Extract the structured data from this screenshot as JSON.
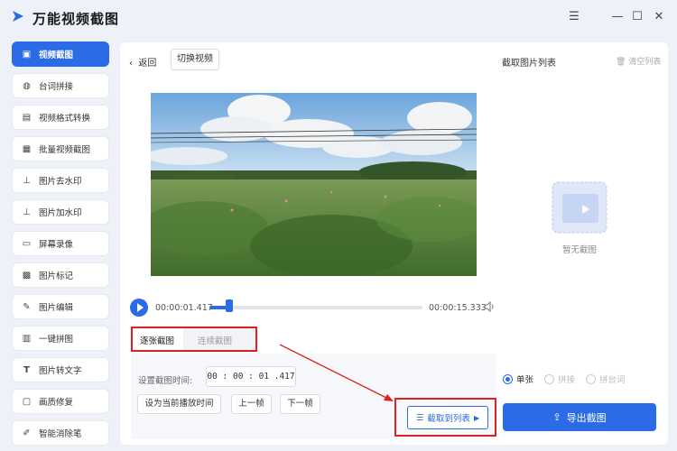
{
  "app": {
    "title": "万能视频截图"
  },
  "window_controls": {
    "menu": "☰",
    "minimize": "—",
    "maximize": "☐",
    "close": "✕"
  },
  "sidebar": {
    "items": [
      {
        "label": "视频截图",
        "icon": "image-icon",
        "active": true
      },
      {
        "label": "台词拼接",
        "icon": "subtitle-icon"
      },
      {
        "label": "视频格式转换",
        "icon": "convert-icon"
      },
      {
        "label": "批量视频截图",
        "icon": "batch-icon"
      },
      {
        "label": "图片去水印",
        "icon": "stamp-icon"
      },
      {
        "label": "图片加水印",
        "icon": "stamp-add-icon"
      },
      {
        "label": "屏幕录像",
        "icon": "screen-icon"
      },
      {
        "label": "图片标记",
        "icon": "mark-icon"
      },
      {
        "label": "图片编辑",
        "icon": "edit-icon"
      },
      {
        "label": "一键拼图",
        "icon": "grid-icon"
      },
      {
        "label": "图片转文字",
        "icon": "text-icon"
      },
      {
        "label": "画质修复",
        "icon": "repair-icon"
      },
      {
        "label": "智能消除笔",
        "icon": "eraser-icon"
      }
    ]
  },
  "toolbar": {
    "back_label": "返回",
    "switch_label": "切换视频"
  },
  "right_panel": {
    "title": "截取图片列表",
    "clear_label": "清空列表",
    "empty_label": "暂无截图"
  },
  "player": {
    "current_time": "00:00:01.417",
    "total_time": "00:00:15.333",
    "progress": 0.092
  },
  "tabs": [
    {
      "label": "逐张截图",
      "active": true
    },
    {
      "label": "连续截图",
      "active": false
    }
  ],
  "capture_panel": {
    "set_time_label": "设置截图时间:",
    "time_value": "00 : 00 : 01 .417",
    "set_current_label": "设为当前播放时间",
    "prev_frame_label": "上一帧",
    "next_frame_label": "下一帧",
    "capture_label": "截取到列表"
  },
  "export": {
    "options": [
      {
        "label": "单张",
        "selected": true
      },
      {
        "label": "拼接",
        "selected": false
      },
      {
        "label": "拼台词",
        "selected": false
      }
    ],
    "button_label": "导出截图"
  },
  "colors": {
    "accent": "#2b6be6",
    "highlight": "#e02020"
  }
}
